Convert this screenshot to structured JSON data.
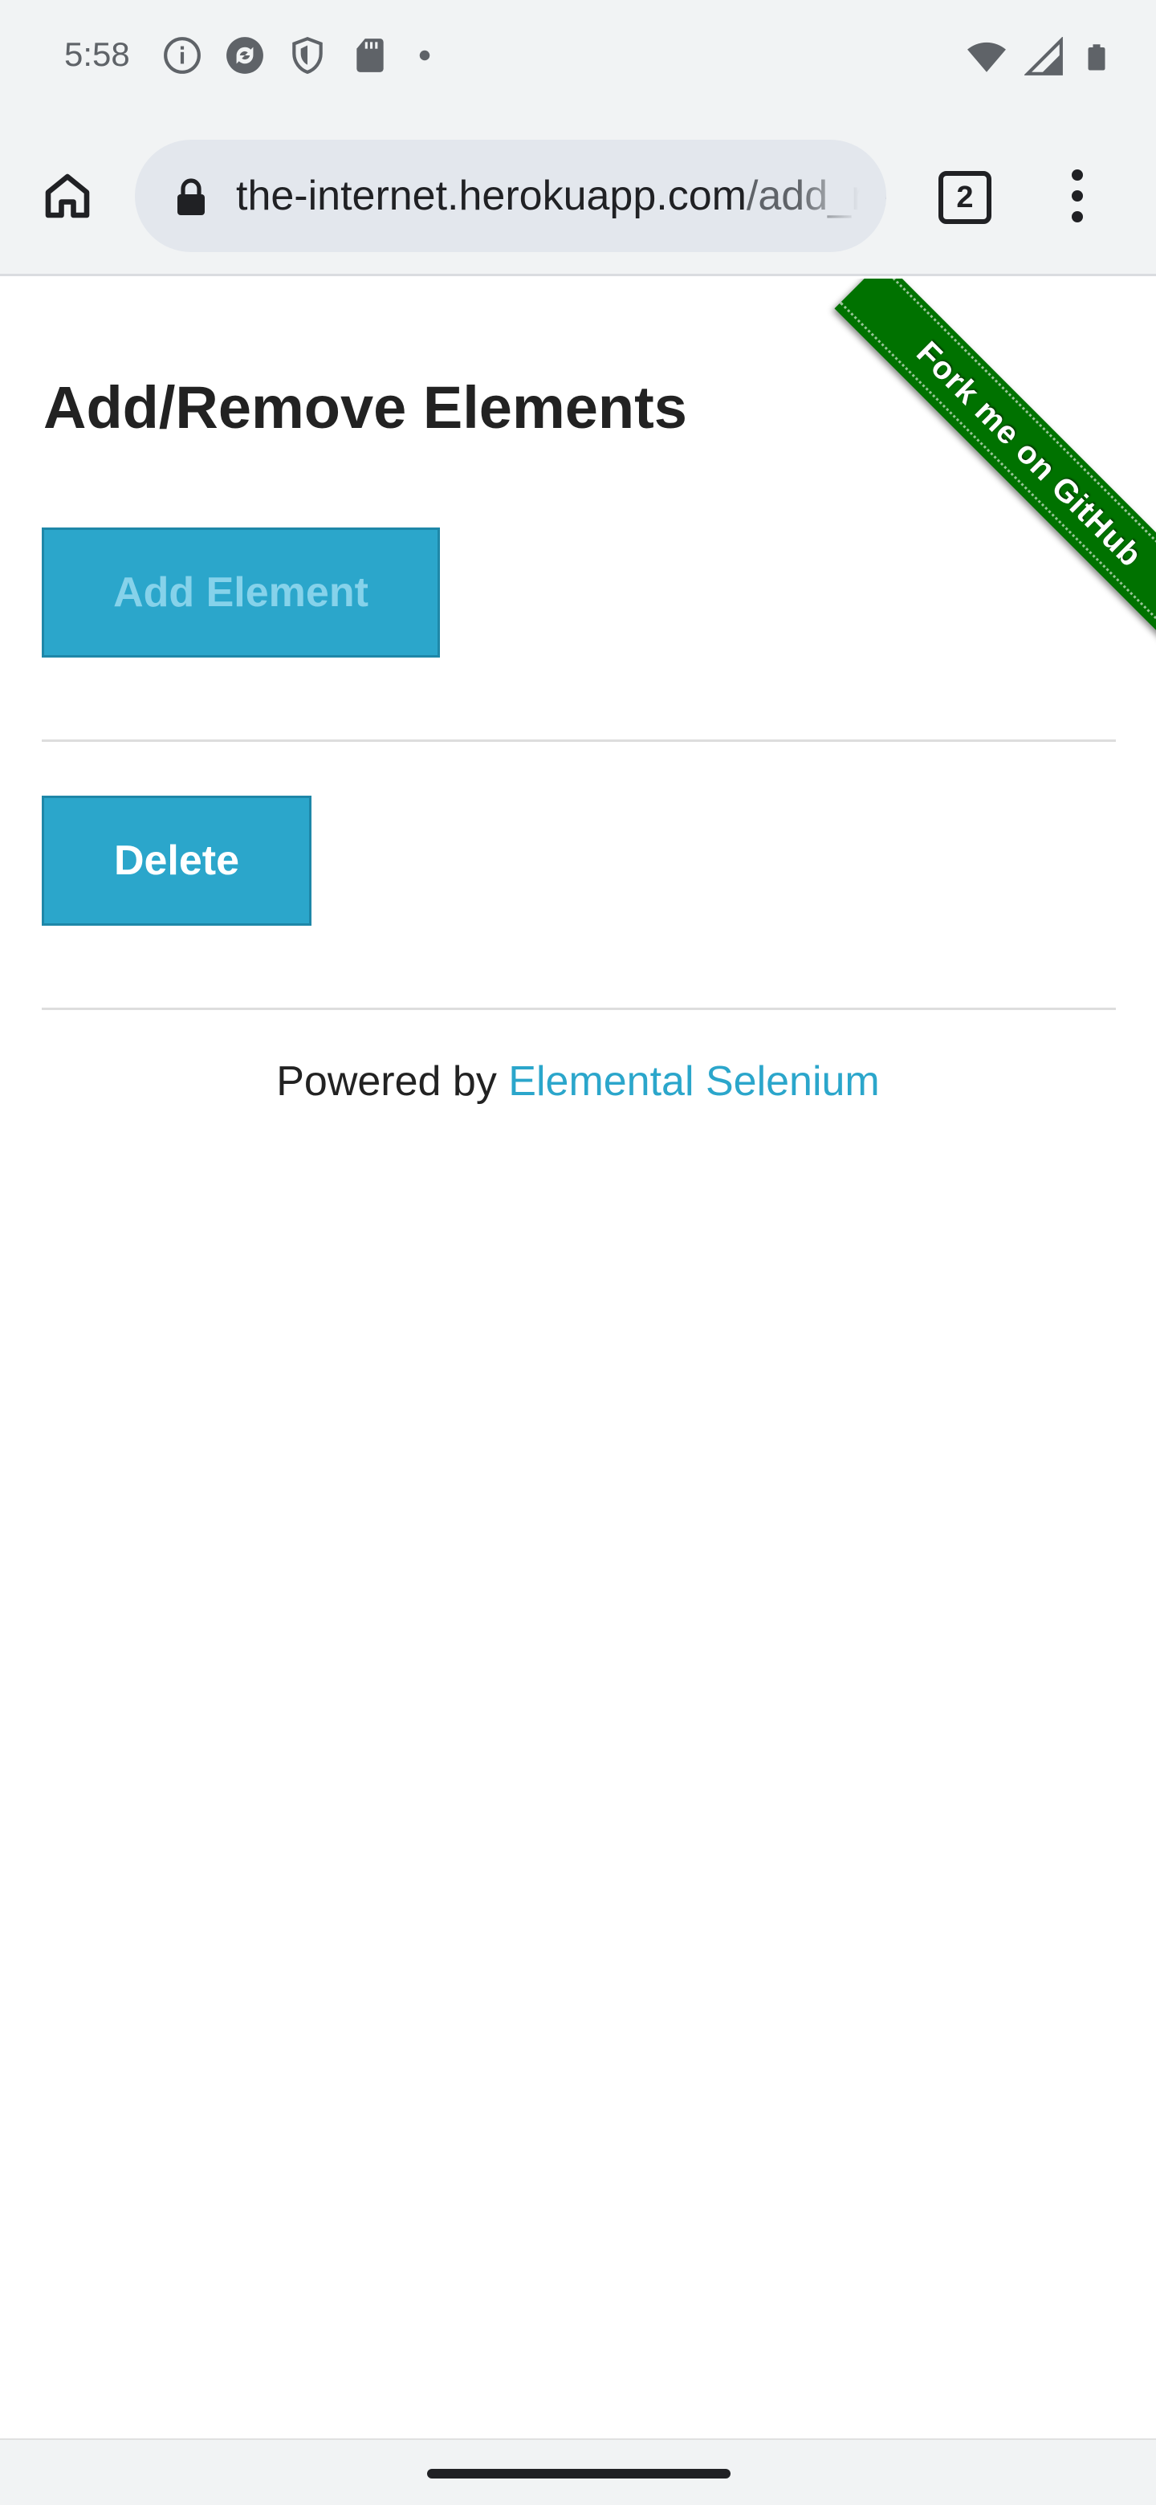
{
  "status_bar": {
    "time": "5:58",
    "left_icons": [
      "info-icon",
      "sync-icon",
      "shield-icon",
      "sd-card-icon",
      "dot-icon"
    ],
    "right_icons": [
      "wifi-icon",
      "signal-icon",
      "battery-icon"
    ]
  },
  "browser": {
    "url_host": "the-internet.herokuapp.com",
    "url_path": "/add_remove_elements/",
    "tab_count": "2",
    "icons": [
      "home-icon",
      "lock-icon",
      "tabs-icon",
      "more-vert-icon"
    ]
  },
  "page": {
    "title": "Add/Remove Elements",
    "add_button": "Add Element",
    "delete_button": "Delete",
    "ribbon": "Fork me on GitHub",
    "footer_prefix": "Powered by ",
    "footer_link": "Elemental Selenium"
  },
  "colors": {
    "button": "#2ba6cb",
    "ribbon": "#007200",
    "link": "#2ba6cb",
    "chrome_bg": "#f1f3f4"
  }
}
